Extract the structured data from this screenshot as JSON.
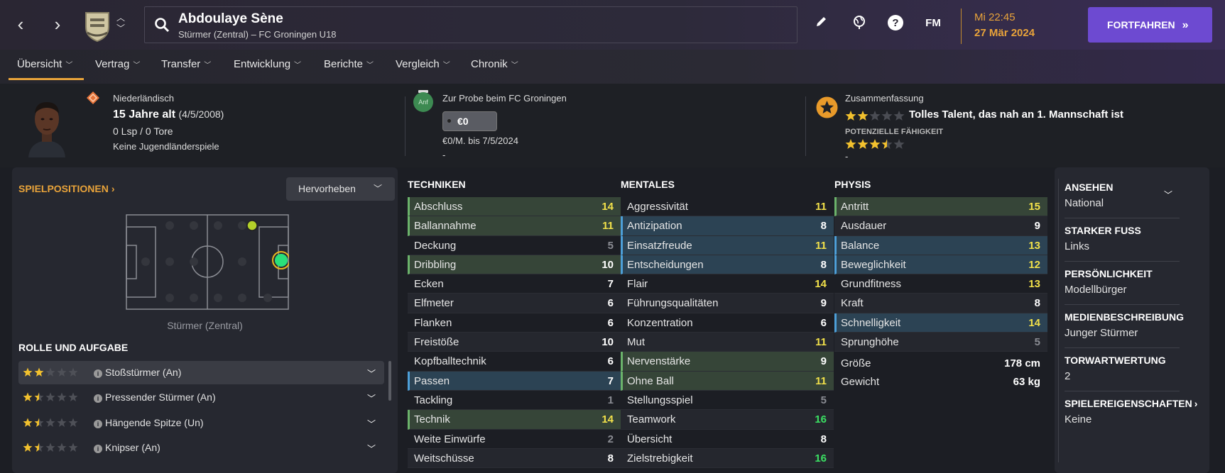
{
  "header": {
    "player_name": "Abdoulaye Sène",
    "player_subtitle": "Stürmer (Zentral) – FC Groningen U18",
    "time": "Mi 22:45",
    "date": "27 Mär 2024",
    "continue_label": "FORTFAHREN",
    "fm_label": "FM"
  },
  "tabs": [
    {
      "label": "Übersicht"
    },
    {
      "label": "Vertrag"
    },
    {
      "label": "Transfer"
    },
    {
      "label": "Entwicklung"
    },
    {
      "label": "Berichte"
    },
    {
      "label": "Vergleich"
    },
    {
      "label": "Chronik"
    }
  ],
  "profile": {
    "nationality": "Niederländisch",
    "age": "15 Jahre alt",
    "dob": "(4/5/2008)",
    "caps": "0 Lsp / 0 Tore",
    "youth": "Keine Jugendländerspiele"
  },
  "contract": {
    "status": "Zur Probe beim FC Groningen",
    "badge": "Anf",
    "value": "€0",
    "wage": "€0/M. bis 7/5/2024",
    "dash": "-"
  },
  "summary": {
    "title": "Zusammenfassung",
    "current_stars": 2,
    "text": "Tolles Talent, das nah an 1. Mannschaft ist",
    "potential_label": "POTENZIELLE FÄHIGKEIT",
    "potential_stars": 3.5,
    "dash": "-"
  },
  "positions": {
    "title": "SPIELPOSITIONEN",
    "highlight_label": "Hervorheben",
    "position_label": "Stürmer (Zentral)"
  },
  "roles": {
    "title": "ROLLE UND AUFGABE",
    "items": [
      {
        "name": "Stoßstürmer (An)",
        "stars": 2
      },
      {
        "name": "Pressender Stürmer (An)",
        "stars": 1.5
      },
      {
        "name": "Hängende Spitze (Un)",
        "stars": 1.5
      },
      {
        "name": "Knipser (An)",
        "stars": 1.5
      }
    ]
  },
  "technical": {
    "title": "TECHNIKEN",
    "items": [
      {
        "name": "Abschluss",
        "value": 14,
        "hl": "g",
        "c": "yl"
      },
      {
        "name": "Ballannahme",
        "value": 11,
        "hl": "g",
        "c": "yl"
      },
      {
        "name": "Deckung",
        "value": 5,
        "hl": "",
        "c": "gr"
      },
      {
        "name": "Dribbling",
        "value": 10,
        "hl": "g",
        "c": "wh"
      },
      {
        "name": "Ecken",
        "value": 7,
        "hl": "",
        "c": "wh"
      },
      {
        "name": "Elfmeter",
        "value": 6,
        "hl": "",
        "c": "wh"
      },
      {
        "name": "Flanken",
        "value": 6,
        "hl": "",
        "c": "wh"
      },
      {
        "name": "Freistöße",
        "value": 10,
        "hl": "",
        "c": "wh"
      },
      {
        "name": "Kopfballtechnik",
        "value": 6,
        "hl": "",
        "c": "wh"
      },
      {
        "name": "Passen",
        "value": 7,
        "hl": "b",
        "c": "wh"
      },
      {
        "name": "Tackling",
        "value": 1,
        "hl": "",
        "c": "gr"
      },
      {
        "name": "Technik",
        "value": 14,
        "hl": "g",
        "c": "yl"
      },
      {
        "name": "Weite Einwürfe",
        "value": 2,
        "hl": "",
        "c": "gr"
      },
      {
        "name": "Weitschüsse",
        "value": 8,
        "hl": "",
        "c": "wh"
      }
    ]
  },
  "mental": {
    "title": "MENTALES",
    "items": [
      {
        "name": "Aggressivität",
        "value": 11,
        "hl": "",
        "c": "yl"
      },
      {
        "name": "Antizipation",
        "value": 8,
        "hl": "b",
        "c": "wh"
      },
      {
        "name": "Einsatzfreude",
        "value": 11,
        "hl": "b",
        "c": "yl"
      },
      {
        "name": "Entscheidungen",
        "value": 8,
        "hl": "b",
        "c": "wh"
      },
      {
        "name": "Flair",
        "value": 14,
        "hl": "",
        "c": "yl"
      },
      {
        "name": "Führungsqualitäten",
        "value": 9,
        "hl": "",
        "c": "wh"
      },
      {
        "name": "Konzentration",
        "value": 6,
        "hl": "",
        "c": "wh"
      },
      {
        "name": "Mut",
        "value": 11,
        "hl": "",
        "c": "yl"
      },
      {
        "name": "Nervenstärke",
        "value": 9,
        "hl": "g",
        "c": "wh"
      },
      {
        "name": "Ohne Ball",
        "value": 11,
        "hl": "g",
        "c": "yl"
      },
      {
        "name": "Stellungsspiel",
        "value": 5,
        "hl": "",
        "c": "gr"
      },
      {
        "name": "Teamwork",
        "value": 16,
        "hl": "",
        "c": "bg"
      },
      {
        "name": "Übersicht",
        "value": 8,
        "hl": "",
        "c": "wh"
      },
      {
        "name": "Zielstrebigkeit",
        "value": 16,
        "hl": "",
        "c": "bg"
      }
    ]
  },
  "physical": {
    "title": "PHYSIS",
    "items": [
      {
        "name": "Antritt",
        "value": 15,
        "hl": "g",
        "c": "yl"
      },
      {
        "name": "Ausdauer",
        "value": 9,
        "hl": "",
        "c": "wh"
      },
      {
        "name": "Balance",
        "value": 13,
        "hl": "b",
        "c": "yl"
      },
      {
        "name": "Beweglichkeit",
        "value": 12,
        "hl": "b",
        "c": "yl"
      },
      {
        "name": "Grundfitness",
        "value": 13,
        "hl": "",
        "c": "yl"
      },
      {
        "name": "Kraft",
        "value": 8,
        "hl": "",
        "c": "wh"
      },
      {
        "name": "Schnelligkeit",
        "value": 14,
        "hl": "b",
        "c": "yl"
      },
      {
        "name": "Sprunghöhe",
        "value": 5,
        "hl": "",
        "c": "gr"
      }
    ],
    "height_label": "Größe",
    "height": "178 cm",
    "weight_label": "Gewicht",
    "weight": "63 kg"
  },
  "side": [
    {
      "label": "ANSEHEN",
      "value": "National"
    },
    {
      "label": "STARKER FUSS",
      "value": "Links"
    },
    {
      "label": "PERSÖNLICHKEIT",
      "value": "Modellbürger"
    },
    {
      "label": "MEDIENBESCHREIBUNG",
      "value": "Junger Stürmer"
    },
    {
      "label": "TORWARTWERTUNG",
      "value": "2"
    },
    {
      "label": "SPIELEREIGENSCHAFTEN",
      "value": "Keine"
    }
  ],
  "colors": {
    "accent": "#e8a33a",
    "continue": "#6d4ad1",
    "green_hl": "#364538",
    "blue_hl": "#2c4354",
    "attr_yellow": "#f2e14a",
    "attr_green": "#3be063"
  }
}
